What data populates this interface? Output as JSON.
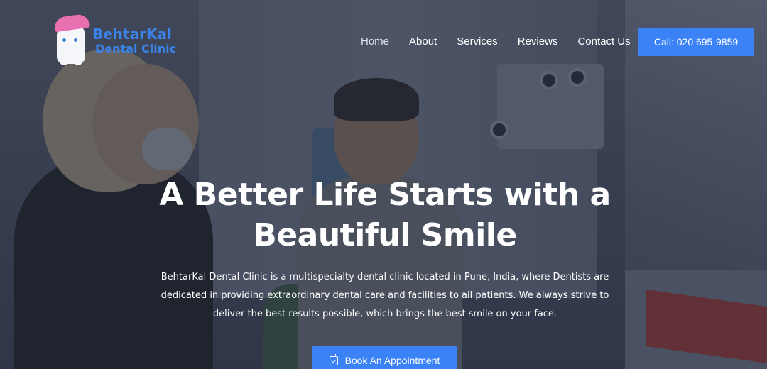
{
  "logo": {
    "line1": "BehtarKal",
    "line2": "Dental Clinic"
  },
  "nav": {
    "items": [
      {
        "label": "Home",
        "active": true
      },
      {
        "label": "About"
      },
      {
        "label": "Services"
      },
      {
        "label": "Reviews"
      },
      {
        "label": "Contact Us"
      }
    ],
    "call_button": "Call: 020 695-9859"
  },
  "hero": {
    "headline_line1": "A Better Life Starts with a",
    "headline_line2": "Beautiful Smile",
    "description_line1": "BehtarKal Dental Clinic is a multispecialty dental clinic located in Pune, India, where Dentists are",
    "description_line2": "dedicated in providing extraordinary dental care and facilities to all patients. We always strive to",
    "description_line3": "deliver the best results possible, which brings the best smile on your face.",
    "cta_label": "Book An Appointment",
    "cta_icon": "calendar-check-icon"
  },
  "colors": {
    "accent": "#3b82f6",
    "logo": "#3b82e6",
    "tuft": "#e86fb0"
  }
}
